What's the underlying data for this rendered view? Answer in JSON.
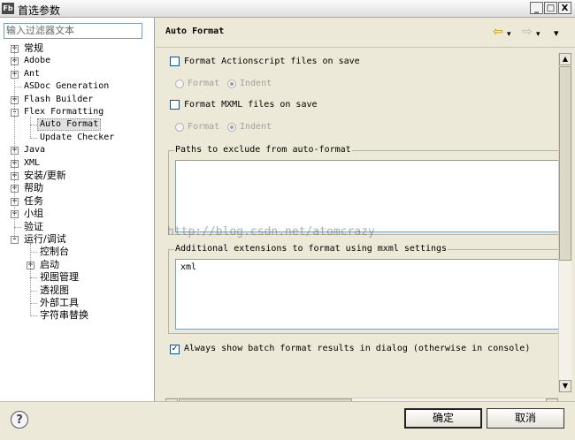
{
  "window": {
    "app_icon": "Fb",
    "title": "首选参数",
    "minimize": "_",
    "maximize": "□",
    "close": "X"
  },
  "filter": {
    "placeholder": "输入过滤器文本"
  },
  "tree": [
    {
      "label": "常规",
      "expander": "+",
      "cjk": true
    },
    {
      "label": "Adobe",
      "expander": "+"
    },
    {
      "label": "Ant",
      "expander": "+"
    },
    {
      "label": "ASDoc Generation",
      "expander": ""
    },
    {
      "label": "Flash Builder",
      "expander": "+"
    },
    {
      "label": "Flex Formatting",
      "expander": "-"
    },
    {
      "label": "Auto Format",
      "expander": "",
      "selected": true
    },
    {
      "label": "Update Checker",
      "expander": ""
    },
    {
      "label": "Java",
      "expander": "+"
    },
    {
      "label": "XML",
      "expander": "+"
    },
    {
      "label": "安装/更新",
      "expander": "+",
      "cjk": true
    },
    {
      "label": "帮助",
      "expander": "+",
      "cjk": true
    },
    {
      "label": "任务",
      "expander": "+",
      "cjk": true
    },
    {
      "label": "小组",
      "expander": "+",
      "cjk": true
    },
    {
      "label": "验证",
      "expander": "",
      "cjk": true
    },
    {
      "label": "运行/调试",
      "expander": "-",
      "cjk": true
    },
    {
      "label": "控制台",
      "expander": "",
      "cjk": true
    },
    {
      "label": "启动",
      "expander": "+",
      "cjk": true
    },
    {
      "label": "视图管理",
      "expander": "",
      "cjk": true
    },
    {
      "label": "透视图",
      "expander": "",
      "cjk": true
    },
    {
      "label": "外部工具",
      "expander": "",
      "cjk": true
    },
    {
      "label": "字符串替换",
      "expander": "",
      "cjk": true
    }
  ],
  "header": {
    "title": "Auto Format",
    "back_icon": "⇦",
    "fwd_icon": "⇨",
    "dropdown_icon": "▾"
  },
  "settings": {
    "as_format_label": "Format Actionscript files on save",
    "mxml_format_label": "Format MXML files on save",
    "radio_format": "Format",
    "radio_indent": "Indent",
    "exclude_title": "Paths to exclude from auto-format",
    "watermark": "http://blog.csdn.net/atomcrazy",
    "ext_title": "Additional extensions to format using mxml settings",
    "ext_value": "xml",
    "batch_label": "Always show batch format results in dialog (otherwise in console)",
    "batch_checked": "✓"
  },
  "buttons": {
    "help": "?",
    "ok": "确定",
    "cancel": "取消"
  }
}
